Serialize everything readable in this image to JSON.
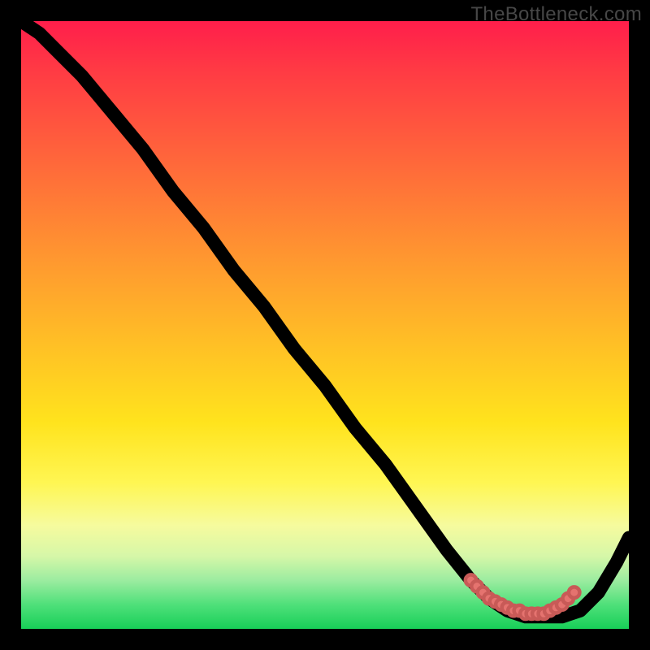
{
  "watermark": "TheBottleneck.com",
  "colors": {
    "frame_bg": "#000000",
    "watermark": "#474747",
    "gradient_top": "#ff1e4b",
    "gradient_bottom": "#18cf58",
    "curve": "#000000",
    "dots": "#e5736f"
  },
  "chart_data": {
    "type": "line",
    "title": "",
    "xlabel": "",
    "ylabel": "",
    "xlim": [
      0,
      100
    ],
    "ylim": [
      0,
      100
    ],
    "series": [
      {
        "name": "bottleneck-curve",
        "x": [
          0,
          3,
          6,
          10,
          15,
          20,
          25,
          30,
          35,
          40,
          45,
          50,
          55,
          60,
          65,
          70,
          74,
          77,
          80,
          83,
          86,
          89,
          92,
          95,
          98,
          100
        ],
        "y": [
          100,
          98,
          95,
          91,
          85,
          79,
          72,
          66,
          59,
          53,
          46,
          40,
          33,
          27,
          20,
          13,
          8,
          5,
          3,
          2,
          2,
          2,
          3,
          6,
          11,
          15
        ]
      }
    ],
    "highlight_points": {
      "name": "low-bottleneck-cluster",
      "x": [
        74,
        75,
        76,
        77,
        78,
        79,
        80,
        81,
        82,
        83,
        84,
        85,
        86,
        87,
        88,
        89,
        90,
        91
      ],
      "y": [
        8,
        7,
        6,
        5,
        4.5,
        4,
        3.5,
        3,
        3,
        2.5,
        2.5,
        2.5,
        2.5,
        3,
        3.5,
        4,
        5,
        6
      ]
    }
  }
}
